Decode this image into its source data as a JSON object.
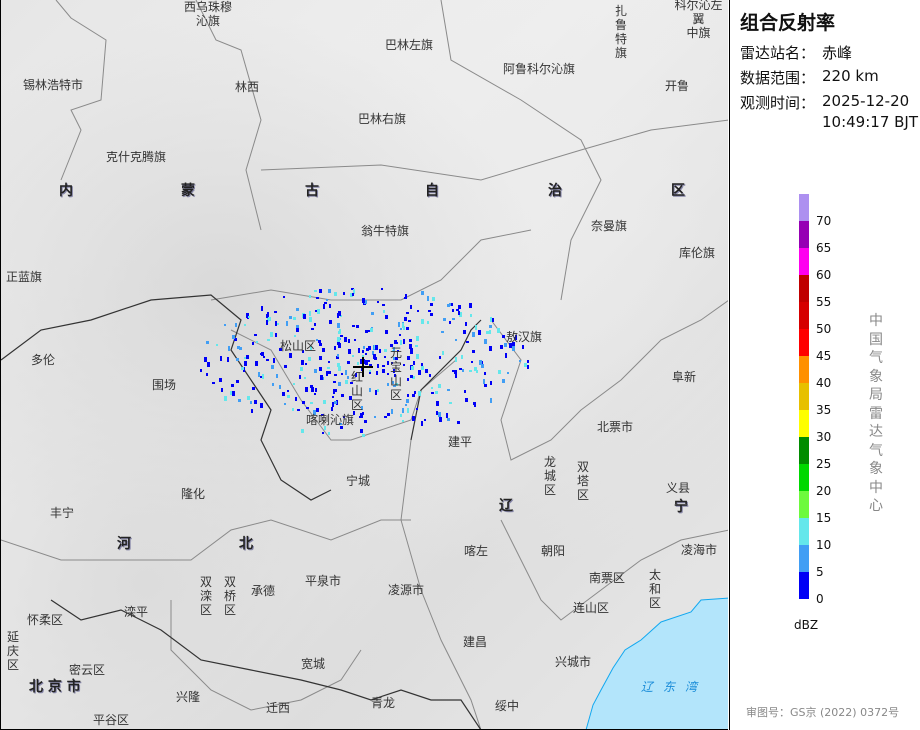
{
  "panel": {
    "title": "组合反射率",
    "station_label": "雷达站名：",
    "station": "赤峰",
    "range_label": "数据范围：",
    "range": "220 km",
    "time_label": "观测时间：",
    "date": "2025-12-20",
    "time": "10:49:17 BJT",
    "legend": {
      "unit": "dBZ",
      "ticks": [
        "0",
        "5",
        "10",
        "15",
        "20",
        "25",
        "30",
        "35",
        "40",
        "45",
        "50",
        "55",
        "60",
        "65",
        "70"
      ],
      "colors": [
        "#0000f6",
        "#419ef4",
        "#64e7eb",
        "#6dfa3d",
        "#00d800",
        "#018c00",
        "#fefe00",
        "#e7c000",
        "#ff9000",
        "#ff0000",
        "#d60000",
        "#c00000",
        "#ff00f0",
        "#9600b4",
        "#ad90f0"
      ]
    },
    "organization": "中国气象局雷达气象中心",
    "approval": "审图号：GS京 (2022) 0372号"
  },
  "map": {
    "sea_color": "#b3e5fb",
    "labels": [
      "西乌珠穆\n沁旗",
      "巴林左旗",
      "阿鲁科尔沁旗",
      "扎\n鲁\n特\n旗",
      "科尔沁左翼\n中旗",
      "开鲁",
      "锡林浩特市",
      "林西",
      "巴林右旗",
      "克什克腾旗",
      "翁牛特旗",
      "奈曼旗",
      "库伦旗",
      "正蓝旗",
      "松山区",
      "敖汉旗",
      "多伦",
      "元\n宝\n山\n区",
      "红\n山\n区",
      "围场",
      "喀喇沁旗",
      "北票市",
      "建平",
      "阜新",
      "龙\n城\n区",
      "双\n塔\n区",
      "宁城",
      "隆化",
      "义县",
      "丰宁",
      "喀左",
      "朝阳",
      "凌海市",
      "双\n滦\n区",
      "双\n桥\n区",
      "承德",
      "平泉市",
      "凌源市",
      "南票区",
      "太\n和\n区",
      "怀柔区",
      "滦平",
      "连山区",
      "延\n庆\n区",
      "建昌",
      "宽城",
      "密云区",
      "兴城市",
      "兴隆",
      "迁西",
      "青龙",
      "绥中",
      "平谷区"
    ],
    "region_labels": [
      "内",
      "蒙",
      "古",
      "自",
      "治",
      "区",
      "辽",
      "宁",
      "河",
      "北",
      "北 京 市"
    ],
    "sea_label": "辽东湾"
  }
}
